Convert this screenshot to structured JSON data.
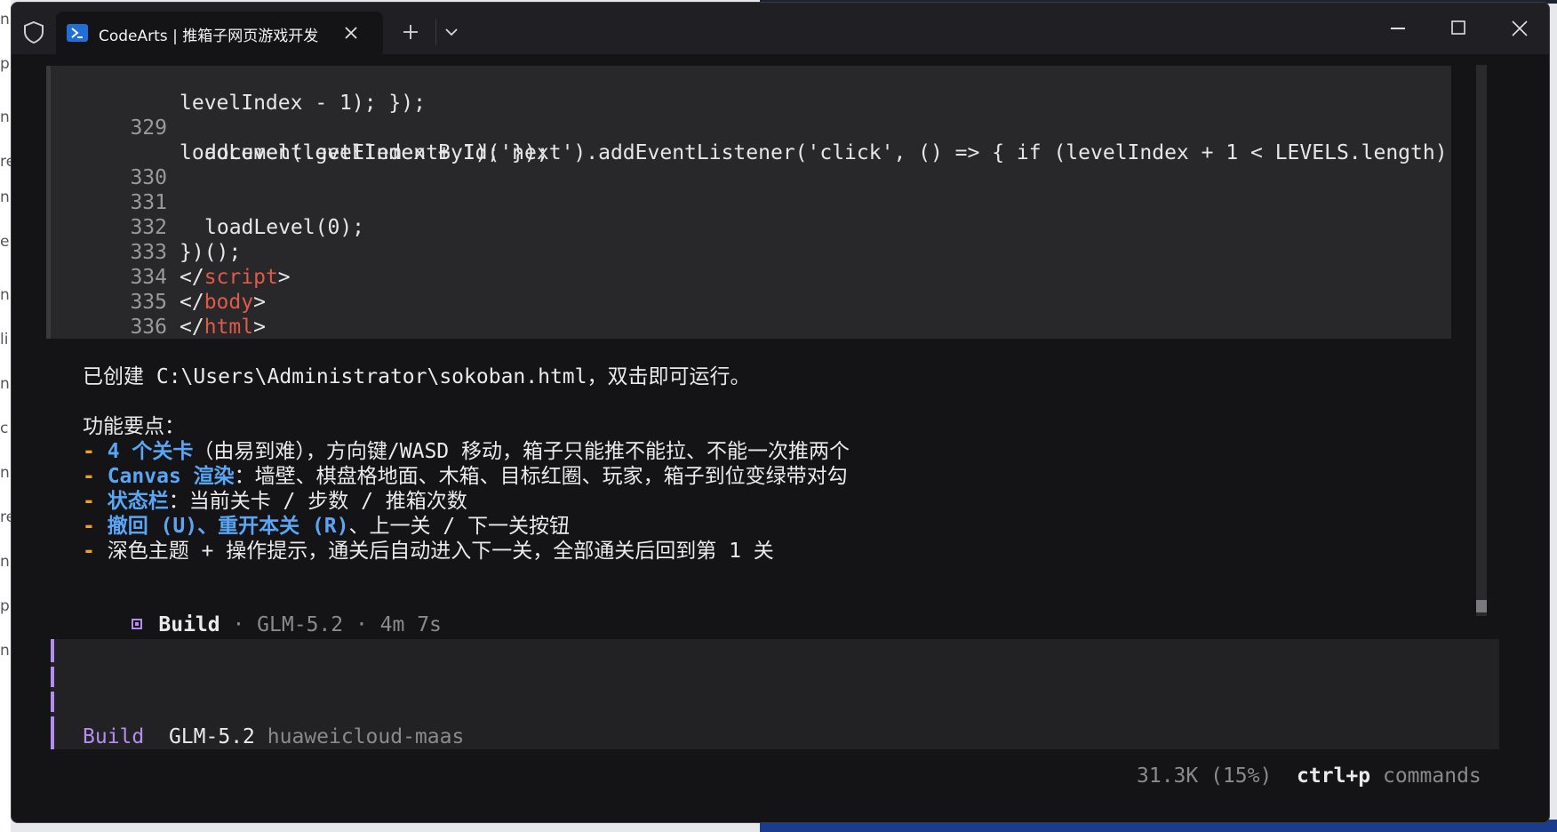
{
  "window": {
    "tab_title": "CodeArts | 推箱子网页游戏开发",
    "controls": [
      "minimize",
      "maximize",
      "close"
    ]
  },
  "code": {
    "lines": [
      {
        "num": "",
        "text": "levelIndex - 1); });"
      },
      {
        "num": "329",
        "text": "document.getElementById('next').addEventListener('click', () => { if (levelIndex + 1 < LEVELS.length)"
      },
      {
        "num": "",
        "text": "loadLevel(levelIndex + 1); });"
      },
      {
        "num": "330",
        "text": ""
      },
      {
        "num": "331",
        "text": "loadLevel(0);"
      },
      {
        "num": "332",
        "text": "})();"
      },
      {
        "num": "333",
        "open": "</",
        "tag": "script",
        "close": ">"
      },
      {
        "num": "334",
        "open": "</",
        "tag": "body",
        "close": ">"
      },
      {
        "num": "335",
        "open": "</",
        "tag": "html",
        "close": ">"
      },
      {
        "num": "336",
        "text": ""
      }
    ]
  },
  "message": {
    "created": "已创建 C:\\Users\\Administrator\\sokoban.html，双击即可运行。",
    "features_title": "功能要点：",
    "bullets": [
      {
        "dash": "- ",
        "strong": "4 个关卡",
        "rest": "（由易到难），方向键/WASD 移动，箱子只能推不能拉、不能一次推两个"
      },
      {
        "dash": "- ",
        "strong": "Canvas 渲染",
        "rest": "：墙壁、棋盘格地面、木箱、目标红圈、玩家，箱子到位变绿带对勾"
      },
      {
        "dash": "- ",
        "strong": "状态栏",
        "rest": "：当前关卡 / 步数 / 推箱次数"
      },
      {
        "dash": "- ",
        "strong": "撤回 (U)、重开本关 (R)",
        "rest": "、上一关 / 下一关按钮"
      },
      {
        "dash": "- ",
        "strong": "",
        "rest": "深色主题 + 操作提示，通关后自动进入下一关，全部通关后回到第 1 关"
      }
    ]
  },
  "build_info": {
    "label": "Build",
    "meta": " · GLM-5.2 · 4m 7s"
  },
  "prompt": {
    "mode": "Build",
    "model": "GLM-5.2",
    "provider": "huaweicloud-maas"
  },
  "footer": {
    "context": "31.3K (15%)",
    "shortcut": "ctrl+p",
    "shortcut_label": "commands"
  },
  "colors": {
    "accent_purple": "#b58cf0",
    "highlight_blue": "#5aa6f5",
    "bullet_orange": "#f0a030",
    "tag_red": "#e05a48"
  },
  "desktop_edge_fragments": [
    "n",
    "p",
    "n",
    "re",
    "n",
    "e",
    "n",
    "li",
    "n",
    "c",
    "n",
    "re",
    "n",
    "p",
    "n"
  ]
}
